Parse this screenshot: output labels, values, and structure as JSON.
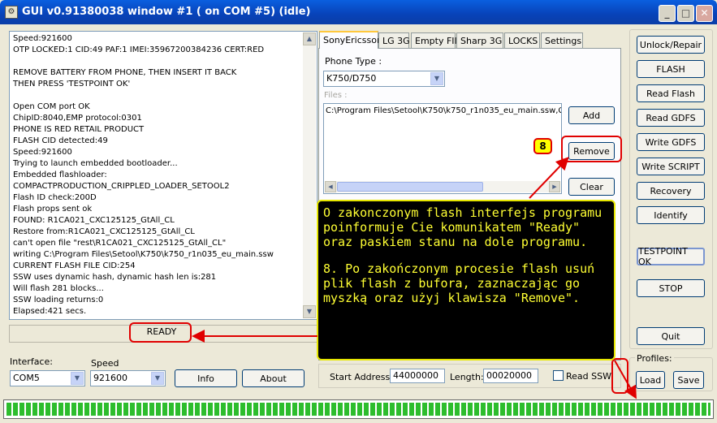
{
  "window": {
    "title": "GUI v0.91380038 window #1 ( on COM #5) (idle)",
    "app_icon": "app-icon",
    "min_glyph": "_",
    "max_glyph": "□",
    "close_glyph": "✕"
  },
  "log": {
    "lines": [
      "Speed:921600",
      "OTP LOCKED:1 CID:49 PAF:1 IMEI:35967200384236 CERT:RED",
      "",
      "REMOVE BATTERY FROM PHONE, THEN INSERT IT BACK",
      "THEN PRESS 'TESTPOINT OK'",
      "",
      "Open COM port OK",
      "ChipID:8040,EMP protocol:0301",
      "PHONE IS RED RETAIL PRODUCT",
      "FLASH CID detected:49",
      "Speed:921600",
      "Trying to launch embedded bootloader...",
      "Embedded flashloader:",
      "COMPACTPRODUCTION_CRIPPLED_LOADER_SETOOL2",
      "Flash ID check:200D",
      "Flash props sent ok",
      "FOUND: R1CA021_CXC125125_GtAll_CL",
      "Restore from:R1CA021_CXC125125_GtAll_CL",
      "can't open file \"rest\\R1CA021_CXC125125_GtAll_CL\"",
      "writing C:\\Program Files\\Setool\\K750\\k750_r1n035_eu_main.ssw",
      "CURRENT FLASH FILE CID:254",
      "SSW uses dynamic hash, dynamic hash len is:281",
      "Will flash 281 blocks...",
      "SSW loading returns:0",
      "Elapsed:421 secs."
    ]
  },
  "status": {
    "text": "READY"
  },
  "connection": {
    "interface_label": "Interface:",
    "interface_value": "COM5",
    "speed_label": "Speed",
    "speed_value": "921600",
    "info_button": "Info",
    "about_button": "About"
  },
  "tabs": [
    {
      "label": "SonyEricsson",
      "active": true
    },
    {
      "label": "LG 3G"
    },
    {
      "label": "Empty FIll"
    },
    {
      "label": "Sharp 3G"
    },
    {
      "label": "LOCKS"
    },
    {
      "label": "Settings"
    }
  ],
  "sonyericsson": {
    "phone_type_label": "Phone Type :",
    "phone_type_value": "K750/D750",
    "files_label": "Files :",
    "files": [
      "C:\\Program Files\\Setool\\K750\\k750_r1n035_eu_main.ssw,C:"
    ],
    "add_button": "Add",
    "remove_button": "Remove",
    "clear_button": "Clear",
    "start_address_label": "Start Address:",
    "start_address_value": "44000000",
    "length_label": "Length:",
    "length_value": "00020000",
    "read_ssw_label": "Read SSW"
  },
  "actions": {
    "unlock": "Unlock/Repair",
    "flash": "FLASH",
    "read_flash": "Read Flash",
    "read_gdfs": "Read GDFS",
    "write_gdfs": "Write GDFS",
    "write_script": "Write SCRIPT",
    "recovery": "Recovery",
    "identify": "Identify",
    "testpoint": "TESTPOINT OK",
    "stop": "STOP",
    "quit": "Quit"
  },
  "profiles": {
    "label": "Profiles:",
    "load": "Load",
    "save": "Save"
  },
  "progress": {
    "value": 1.0
  },
  "annotation": {
    "badge": "8",
    "paragraph1": "O zakonczonym flash interfejs programu poinformuje Cie komunikatem \"Ready\" oraz paskiem stanu na dole programu.",
    "paragraph2": "8. Po zakończonym procesie flash usuń plik flash z bufora, zaznaczając go myszką oraz użyj klawisza \"Remove\".",
    "color_text": "#ffff33",
    "color_ring": "#e00000"
  }
}
